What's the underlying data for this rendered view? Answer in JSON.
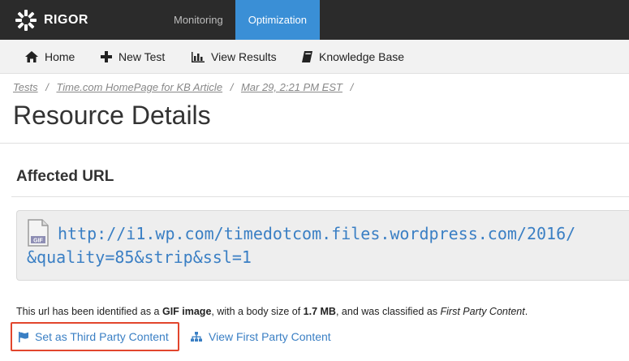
{
  "brand": {
    "name": "RIGOR",
    "accent": "#3a8fd6",
    "icon": "rigor-logo-icon"
  },
  "top_nav": [
    {
      "label": "Monitoring",
      "active": false
    },
    {
      "label": "Optimization",
      "active": true
    }
  ],
  "sub_nav": [
    {
      "label": "Home",
      "icon": "home-icon"
    },
    {
      "label": "New Test",
      "icon": "plus-icon"
    },
    {
      "label": "View Results",
      "icon": "bar-chart-icon"
    },
    {
      "label": "Knowledge Base",
      "icon": "book-icon"
    }
  ],
  "breadcrumb": [
    "Tests",
    "Time.com HomePage for KB Article",
    "Mar 29, 2:21 PM EST"
  ],
  "breadcrumb_separator": "/",
  "page_title": "Resource Details",
  "section_title": "Affected URL",
  "url": {
    "file_icon": "gif-file-icon",
    "file_label": "GIF",
    "line1": "http://i1.wp.com/timedotcom.files.wordpress.com/2016/",
    "line2": "&quality=85&strip&ssl=1"
  },
  "info": {
    "prefix": "This url has been identified as a ",
    "type": "GIF image",
    "middle": ", with a body size of ",
    "size": "1.7 MB",
    "suffix": ", and was classified as ",
    "classification": "First Party Content",
    "end": "."
  },
  "actions": {
    "third_party": {
      "label": "Set as Third Party Content",
      "icon": "flag-icon",
      "highlight": "#e2452d"
    },
    "first_party": {
      "label": "View First Party Content",
      "icon": "sitemap-icon"
    }
  }
}
